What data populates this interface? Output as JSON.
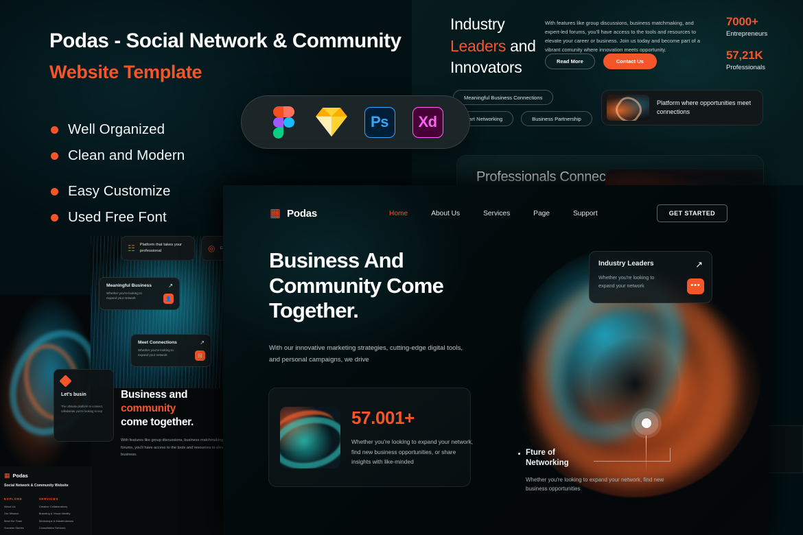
{
  "promo": {
    "title": "Podas - Social Network & Community",
    "subtitle": "Website Template",
    "features": [
      "Well Organized",
      "Clean and Modern",
      "Easy Customize",
      "Used Free Font"
    ],
    "software": [
      "Figma",
      "Sketch",
      "Ps",
      "Xd"
    ]
  },
  "top_right": {
    "heading_line1": "Industry",
    "heading_orange": "Leaders",
    "heading_and": " and",
    "heading_line3": "Innovators",
    "paragraph": "With features like group discussions, business matchmaking, and expert-led forums, you'll have access to the tools and resources to elevate your career or business. Join us today and become part of a vibrant comunity where innovation meets opportunity.",
    "btn_secondary": "Read More",
    "btn_primary": "Contact Us",
    "stats": [
      {
        "value": "7000+",
        "label": "Entrepreneurs"
      },
      {
        "value": "57,21K",
        "label": "Professionals"
      }
    ],
    "tags": [
      "Meaningful Business Connections",
      "Start Networking",
      "Business Partnership"
    ],
    "platform_card": "Platform where opportunities meet connections"
  },
  "professionals_panel": {
    "title": "Professionals Connect"
  },
  "left_mockup": {
    "cards": [
      {
        "title": "Meaningful Business",
        "text": "Whether you're looking to expand your network"
      },
      {
        "title": "Meet Connections",
        "text": "Whether you're looking to expand your network"
      }
    ],
    "heading_line1": "Business and",
    "heading_orange": "community",
    "heading_line3": "come together.",
    "paragraph": "With features like group discussions, business matchmaking, and expert-led forums, you'll have access to the tools and resources to elevate your career or business.",
    "pills": [
      "Platform that takes your professional",
      "Connect with leaders"
    ],
    "lets_card": {
      "title": "Let's busin",
      "text": "The ultimate platform to connect, collaborate you're looking to exp"
    }
  },
  "footer": {
    "brand": "Podas",
    "tagline": "Social Network & Community Website",
    "columns": [
      {
        "heading": "EXPLORE",
        "links": [
          "About Us",
          "Our Mission",
          "Meet the Team",
          "Success Stories"
        ]
      },
      {
        "heading": "SERVICES",
        "links": [
          "Creative Collaborations",
          "Branding & Visual Identity",
          "Workshops & Masterclasses",
          "Consultation Services"
        ]
      }
    ]
  },
  "hero": {
    "brand": "Podas",
    "nav": [
      {
        "label": "Home",
        "active": true
      },
      {
        "label": "About Us",
        "active": false
      },
      {
        "label": "Services",
        "active": false
      },
      {
        "label": "Page",
        "active": false
      },
      {
        "label": "Support",
        "active": false
      }
    ],
    "cta": "GET STARTED",
    "headline_line1": "Business And",
    "headline_line2": "Community Come",
    "headline_line3": "Together.",
    "subtext": "With our innovative marketing strategies, cutting-edge digital tools, and personal campaigns, we drive",
    "stat_card": {
      "value": "57.001+",
      "text": "Whether you're looking to expand your network, find new business opportunities, or share insights with like-minded"
    },
    "industry_card": {
      "title": "Industry Leaders",
      "text": "Whether you're looking to expand your network",
      "arrow": "↗",
      "dots": "•••"
    },
    "future_block": {
      "title_line1": "Fture of",
      "title_line2": "Networking",
      "text": "Whether you're looking to expand your network, find new business opportunities"
    }
  },
  "colors": {
    "accent": "#f4562a",
    "background": "#021014",
    "panel": "#0c1417"
  }
}
